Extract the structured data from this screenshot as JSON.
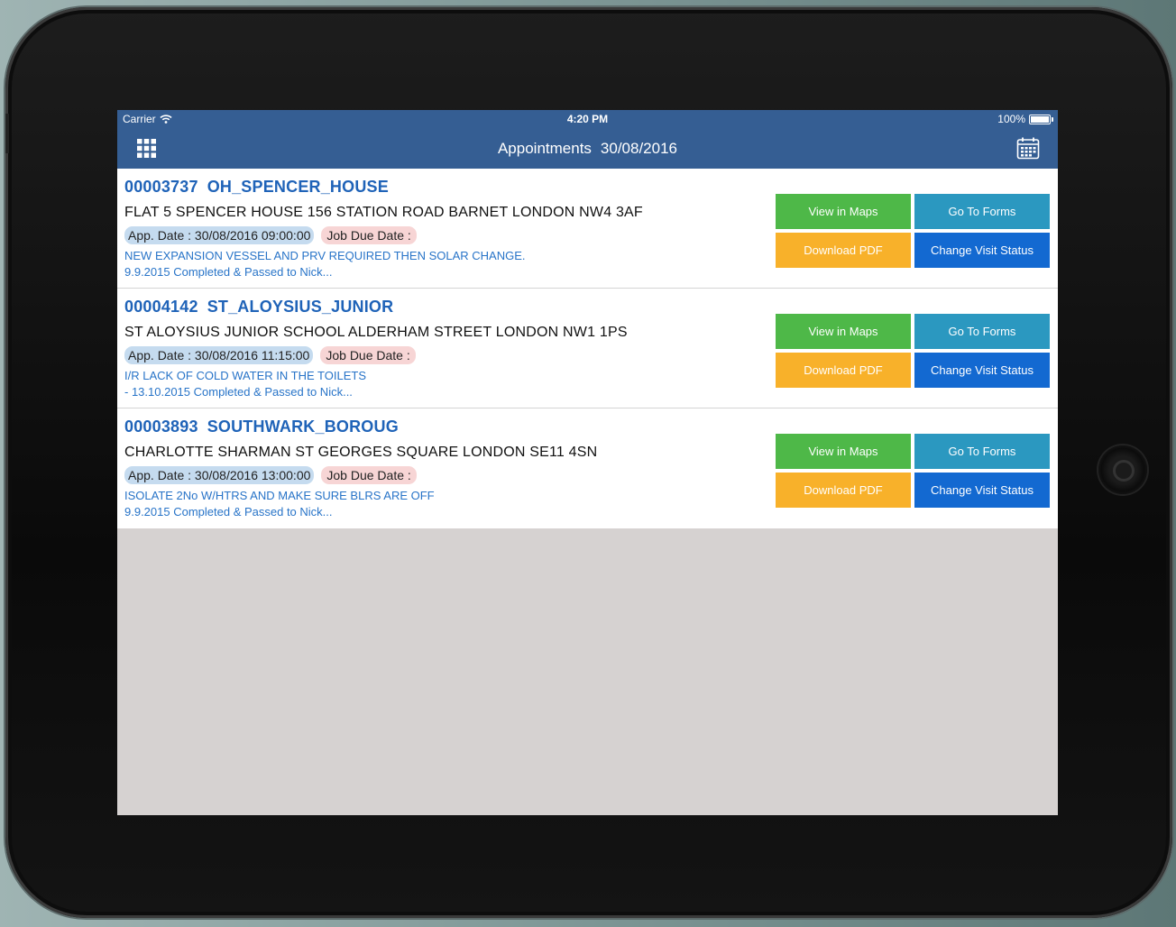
{
  "status_bar": {
    "carrier": "Carrier",
    "time": "4:20 PM",
    "battery": "100%"
  },
  "nav": {
    "title": "Appointments",
    "date": "30/08/2016",
    "left_icon": "grid-icon",
    "right_icon": "calendar-icon"
  },
  "appointments": [
    {
      "id": "00003737",
      "code": "OH_SPENCER_HOUSE",
      "address": "FLAT 5 SPENCER HOUSE 156 STATION ROAD BARNET LONDON NW4 3AF",
      "app_date": "App. Date : 30/08/2016 09:00:00",
      "job_due": "Job Due Date :",
      "desc_line1": "NEW EXPANSION VESSEL AND PRV REQUIRED THEN SOLAR CHANGE.",
      "desc_line2": "9.9.2015 Completed & Passed to Nick..."
    },
    {
      "id": "00004142",
      "code": "ST_ALOYSIUS_JUNIOR",
      "address": "ST ALOYSIUS JUNIOR SCHOOL ALDERHAM STREET LONDON NW1 1PS",
      "app_date": "App. Date : 30/08/2016 11:15:00",
      "job_due": "Job Due Date :",
      "desc_line1": "I/R LACK OF COLD WATER IN THE TOILETS",
      "desc_line2": "- 13.10.2015 Completed & Passed to Nick..."
    },
    {
      "id": "00003893",
      "code": "SOUTHWARK_BOROUG",
      "address": "CHARLOTTE SHARMAN ST GEORGES SQUARE LONDON SE11 4SN",
      "app_date": "App. Date : 30/08/2016 13:00:00",
      "job_due": "Job Due Date :",
      "desc_line1": "ISOLATE 2No W/HTRS AND MAKE SURE BLRS ARE OFF",
      "desc_line2": "9.9.2015 Completed & Passed to Nick..."
    }
  ],
  "buttons": {
    "maps": "View in Maps",
    "forms": "Go To Forms",
    "pdf": "Download PDF",
    "status": "Change Visit Status"
  },
  "colors": {
    "nav_bg": "#355e93",
    "maps": "#4eb848",
    "forms": "#2b98c0",
    "pdf": "#f8b12a",
    "status": "#1369d1",
    "id_text": "#1f63b8"
  }
}
